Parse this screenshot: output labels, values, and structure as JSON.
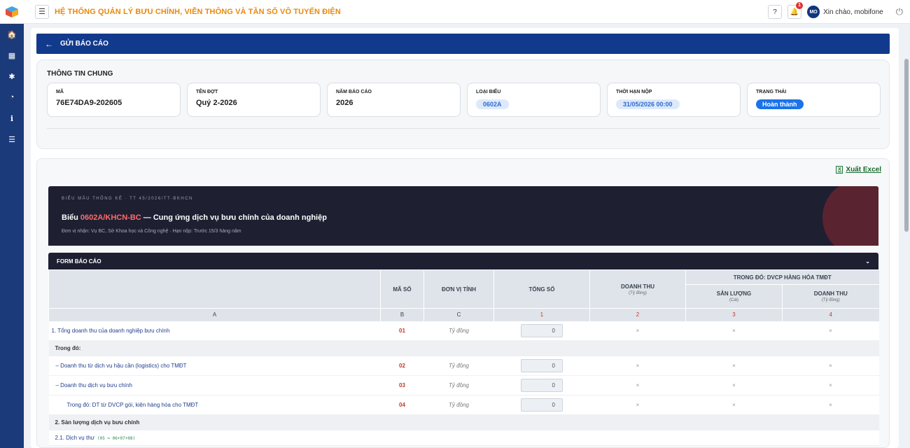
{
  "app": {
    "title": "HỆ THỐNG QUẢN LÝ BƯU CHÍNH, VIỄN THÔNG VÀ TẦN SỐ VÔ TUYẾN ĐIỆN",
    "notification_count": "1",
    "user_initials": "MO",
    "greeting": "Xin chào, mobifone"
  },
  "sidebar": {
    "items": [
      {
        "icon": "home-icon",
        "glyph": "🏠"
      },
      {
        "icon": "map-icon",
        "glyph": "▦"
      },
      {
        "icon": "network-icon",
        "glyph": "✱"
      },
      {
        "icon": "chart-pie-icon",
        "glyph": "◔"
      },
      {
        "icon": "info-icon",
        "glyph": "ℹ"
      },
      {
        "icon": "list-icon",
        "glyph": "☰"
      }
    ]
  },
  "page": {
    "header": "GỬI BÁO CÁO",
    "section_title": "THÔNG TIN CHUNG",
    "cards": [
      {
        "label": "MÃ",
        "value": "76E74DA9-202605"
      },
      {
        "label": "TÊN ĐỢT",
        "value": "Quý 2-2026"
      },
      {
        "label": "NĂM BÁO CÁO",
        "value": "2026"
      },
      {
        "label": "LOẠI BIỂU",
        "value": "0602A"
      },
      {
        "label": "THỜI HẠN NỘP",
        "value": "31/05/2026 00:00"
      },
      {
        "label": "TRẠNG THÁI",
        "value": "Hoàn thành"
      }
    ],
    "export_label": "Xuất Excel"
  },
  "banner": {
    "subtitle": "BIỂU MẪU THỐNG KÊ · TT 45/2026/TT-BKHCN",
    "title_prefix": "Biểu ",
    "title_code": "0602A/KHCN-BC",
    "title_suffix": " — Cung ứng dịch vụ bưu chính của doanh nghiệp",
    "meta": "Đơn vị nhận: Vụ BC, Sở Khoa học và Công nghệ · Hạn nộp: Trước 15/3 hàng năm"
  },
  "form": {
    "title": "FORM BÁO CÁO",
    "headers": {
      "ma_so": "MÃ SỐ",
      "don_vi": "ĐƠN VỊ TÍNH",
      "tong_so": "TỔNG SỐ",
      "doanh_thu": "DOANH THU",
      "doanh_thu_unit": "(Tỷ đồng)",
      "group": "TRONG ĐÓ: DVCP HÀNG HÓA TMĐT",
      "san_luong": "SẢN LƯỢNG",
      "san_luong_unit": "(Cái)",
      "dt2": "DOANH THU",
      "dt2_unit": "(Tỷ đồng)"
    },
    "col_index": [
      "A",
      "B",
      "C",
      "1",
      "2",
      "3",
      "4"
    ],
    "rows": [
      {
        "label": "1. Tổng doanh thu của doanh nghiệp bưu chính",
        "code": "01",
        "unit": "Tỷ đồng",
        "value": "0",
        "x": "×"
      },
      {
        "label": "– Doanh thu từ dịch vụ hậu cần (logistics) cho TMĐT",
        "code": "02",
        "unit": "Tỷ đồng",
        "value": "0",
        "x": "×"
      },
      {
        "label": "– Doanh thu dịch vụ bưu chính",
        "code": "03",
        "unit": "Tỷ đồng",
        "value": "0",
        "x": "×"
      },
      {
        "label": "Trong đó: DT từ DVCP gói, kiện hàng hóa cho TMĐT",
        "code": "04",
        "unit": "Tỷ đồng",
        "value": "0",
        "x": "×"
      }
    ],
    "section_trong_do": "Trong đó:",
    "section_2": "2. Sản lượng dịch vụ bưu chính",
    "group_21": "2.1. Dịch vụ thư",
    "formula_21": "(05 = 06+07+08)"
  }
}
